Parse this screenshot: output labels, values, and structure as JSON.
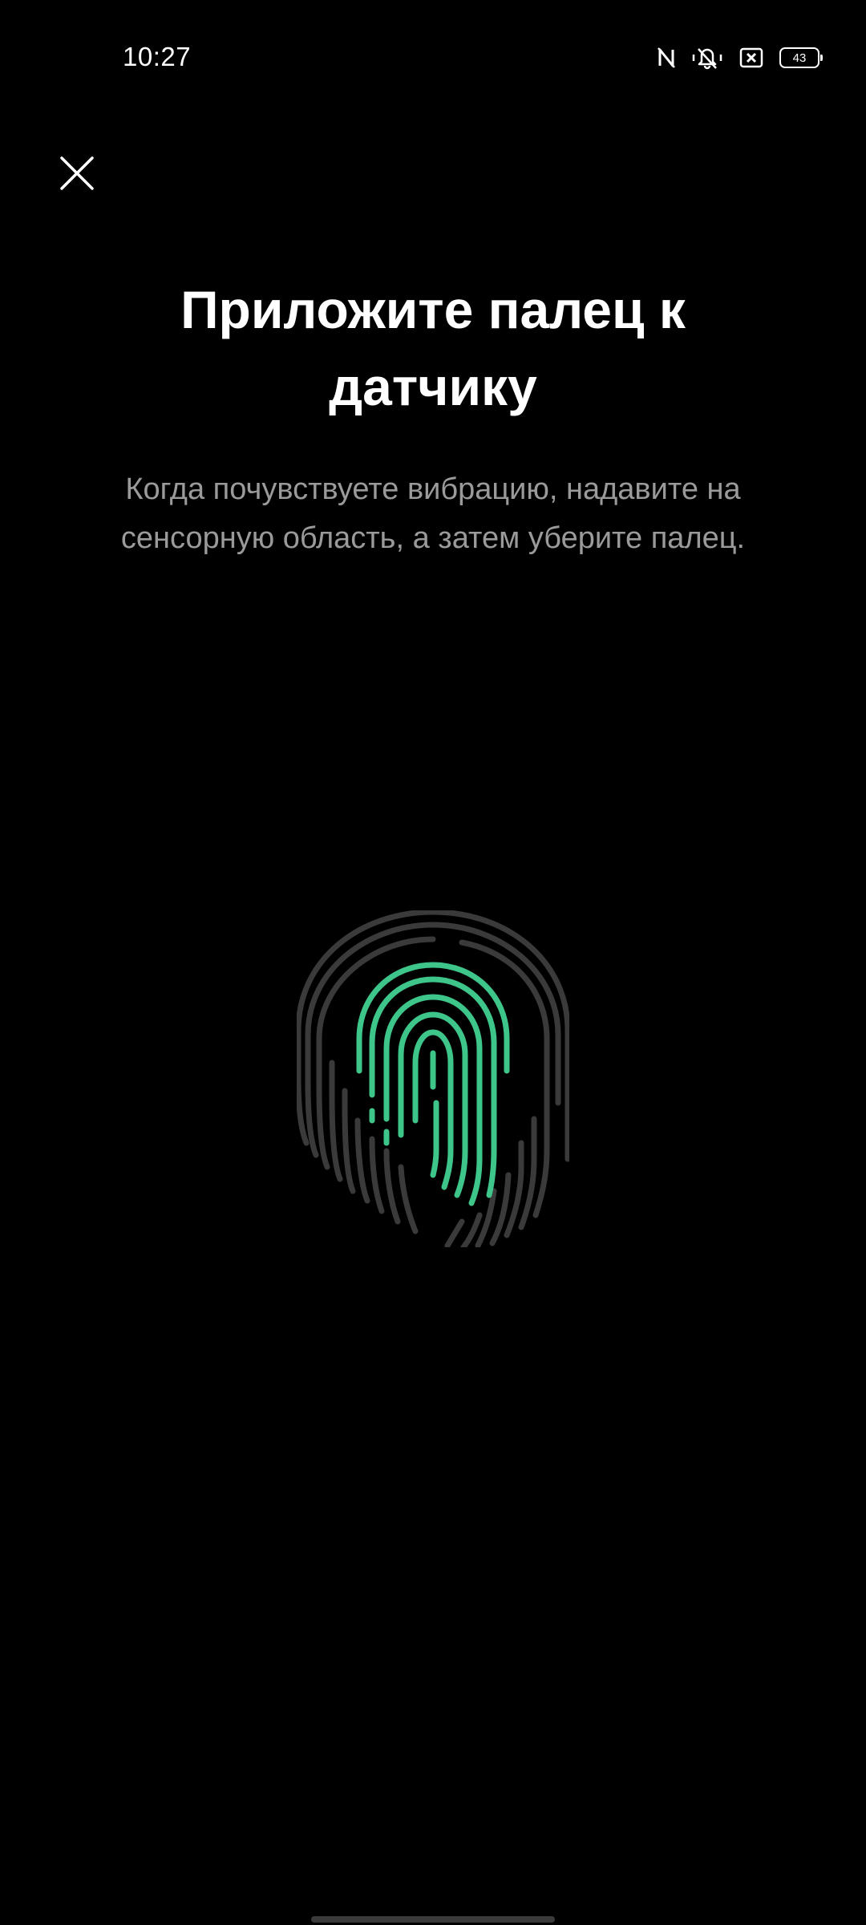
{
  "status_bar": {
    "time": "10:27",
    "battery_level": "43",
    "icons": [
      "nfc-off-icon",
      "vibrate-icon",
      "sim-off-icon",
      "battery-icon"
    ]
  },
  "screen": {
    "title": "Приложите палец к датчику",
    "instruction": "Когда почувствуете вибрацию, надавите на сенсорную область, а затем уберите палец.",
    "close_icon": "close-icon"
  },
  "fingerprint": {
    "icon": "fingerprint-icon",
    "progress": 0.45,
    "colors": {
      "filled": "#3ec68a",
      "unfilled": "#3a3a3a"
    }
  }
}
